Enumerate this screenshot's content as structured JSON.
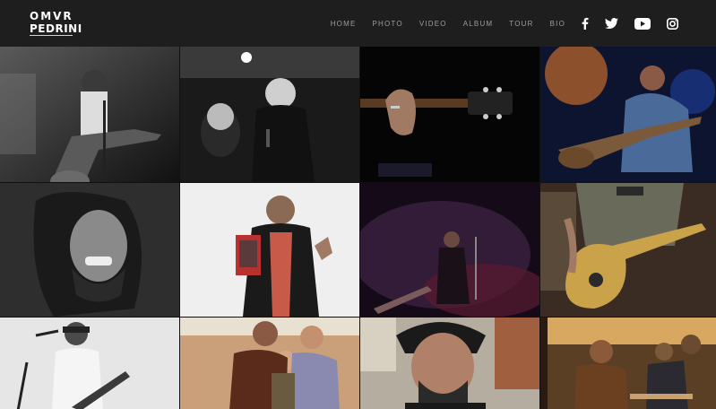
{
  "brand": {
    "line1": "OMVR",
    "line2": "PEDRINI"
  },
  "nav": {
    "items": [
      {
        "label": "HOME"
      },
      {
        "label": "PHOTO"
      },
      {
        "label": "VIDEO"
      },
      {
        "label": "ALBUM"
      },
      {
        "label": "TOUR"
      },
      {
        "label": "BIO"
      }
    ]
  },
  "social": [
    {
      "icon": "facebook-icon"
    },
    {
      "icon": "twitter-icon"
    },
    {
      "icon": "youtube-icon"
    },
    {
      "icon": "instagram-icon"
    }
  ],
  "gallery": {
    "photos": [
      {
        "subject": "guitarist-live-bw"
      },
      {
        "subject": "duet-singing-bw"
      },
      {
        "subject": "hand-on-guitar-dark"
      },
      {
        "subject": "guitarist-stage-lights"
      },
      {
        "subject": "portrait-laughing-bw"
      },
      {
        "subject": "holding-magazine"
      },
      {
        "subject": "stage-smoke-purple"
      },
      {
        "subject": "guitarist-closeup-warm"
      },
      {
        "subject": "singer-guitar-bw"
      },
      {
        "subject": "group-photo"
      },
      {
        "subject": "portrait-smiling"
      },
      {
        "subject": "cafe-band"
      }
    ]
  }
}
